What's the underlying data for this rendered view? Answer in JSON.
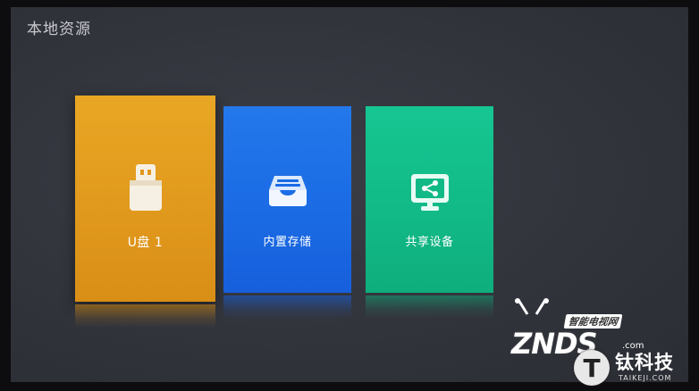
{
  "header": {
    "title": "本地资源"
  },
  "tiles": [
    {
      "label": "U盘 1",
      "icon": "usb-drive-icon",
      "color": "#e0981c",
      "focused": true
    },
    {
      "label": "内置存储",
      "icon": "storage-tray-icon",
      "color": "#1a6ae4",
      "focused": false
    },
    {
      "label": "共享设备",
      "icon": "shared-monitor-icon",
      "color": "#11b986",
      "focused": false
    }
  ],
  "watermark": {
    "brand": "ZNDS",
    "tagline": "智能电视网",
    "domain_suffix": ".com",
    "logo_letter": "T",
    "publisher_cn": "钛科技",
    "publisher_en": "TAIKEJI.COM"
  },
  "colors": {
    "background": "#32343c",
    "title_text": "#c9cacf",
    "usb_tile": "#e0981c",
    "storage_tile": "#1a6ae4",
    "share_tile": "#11b986"
  }
}
